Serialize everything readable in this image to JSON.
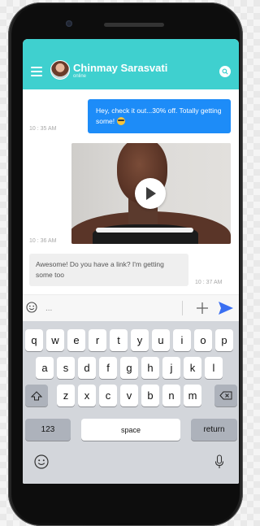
{
  "header": {
    "contact_name": "Chinmay Sarasvati",
    "contact_status": "online",
    "accent_color": "#3fd0cf"
  },
  "messages": [
    {
      "direction": "outgoing",
      "type": "text",
      "text": "Hey, check it out...30% off. Totally getting some!",
      "emoji": "sunglasses-emoji",
      "time": "10 : 35 AM",
      "color": "#1d8cf8"
    },
    {
      "direction": "outgoing",
      "type": "video",
      "time": "10 : 36 AM"
    },
    {
      "direction": "incoming",
      "type": "text",
      "text": "Awesome! Do you have a link? I'm getting some too",
      "time": "10 : 37 AM"
    }
  ],
  "composer": {
    "placeholder": "...",
    "icons": [
      "emoji-icon",
      "plus-icon",
      "send-icon"
    ],
    "send_color": "#3a6ff2"
  },
  "keyboard": {
    "row1": [
      "q",
      "w",
      "e",
      "r",
      "t",
      "y",
      "u",
      "i",
      "o",
      "p"
    ],
    "row2": [
      "a",
      "s",
      "d",
      "f",
      "g",
      "h",
      "j",
      "k",
      "l"
    ],
    "row3": [
      "z",
      "x",
      "c",
      "v",
      "b",
      "n",
      "m"
    ],
    "numbers_label": "123",
    "space_label": "space",
    "return_label": "return",
    "icons": [
      "shift-icon",
      "backspace-icon",
      "emoji-icon",
      "microphone-icon"
    ]
  }
}
